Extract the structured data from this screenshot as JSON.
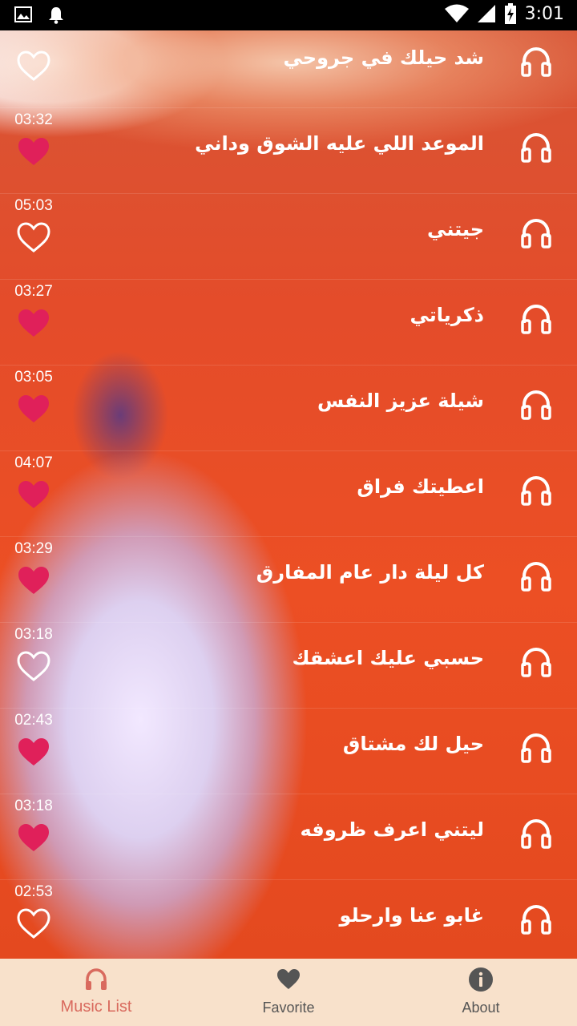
{
  "status_bar": {
    "time": "3:01",
    "icons": [
      "image-icon",
      "bell-icon",
      "wifi-icon",
      "signal-icon",
      "battery-charging-icon"
    ]
  },
  "colors": {
    "favorite_pink": "#e0205a",
    "nav_background": "#f8e1cb",
    "nav_active": "#d96a5e",
    "nav_inactive": "#555555"
  },
  "songs": [
    {
      "title": "شد حيلك في جروحي",
      "duration": "",
      "favorite": false
    },
    {
      "title": "الموعد اللي عليه الشوق وداني",
      "duration": "03:32",
      "favorite": true
    },
    {
      "title": "جيتني",
      "duration": "05:03",
      "favorite": false
    },
    {
      "title": "ذكرياتي",
      "duration": "03:27",
      "favorite": true
    },
    {
      "title": "شيلة عزيز النفس",
      "duration": "03:05",
      "favorite": true
    },
    {
      "title": "اعطيتك فراق",
      "duration": "04:07",
      "favorite": true
    },
    {
      "title": "كل ليلة دار عام المفارق",
      "duration": "03:29",
      "favorite": true
    },
    {
      "title": "حسبي عليك اعشقك",
      "duration": "03:18",
      "favorite": false
    },
    {
      "title": "حيل لك مشتاق",
      "duration": "02:43",
      "favorite": true
    },
    {
      "title": "ليتني اعرف ظروفه",
      "duration": "03:18",
      "favorite": true
    },
    {
      "title": "غابو عنا وارحلو",
      "duration": "02:53",
      "favorite": false
    }
  ],
  "bottom_nav": {
    "items": [
      {
        "label": "Music List",
        "icon": "headphones-icon",
        "active": true
      },
      {
        "label": "Favorite",
        "icon": "heart-icon",
        "active": false
      },
      {
        "label": "About",
        "icon": "info-icon",
        "active": false
      }
    ]
  }
}
